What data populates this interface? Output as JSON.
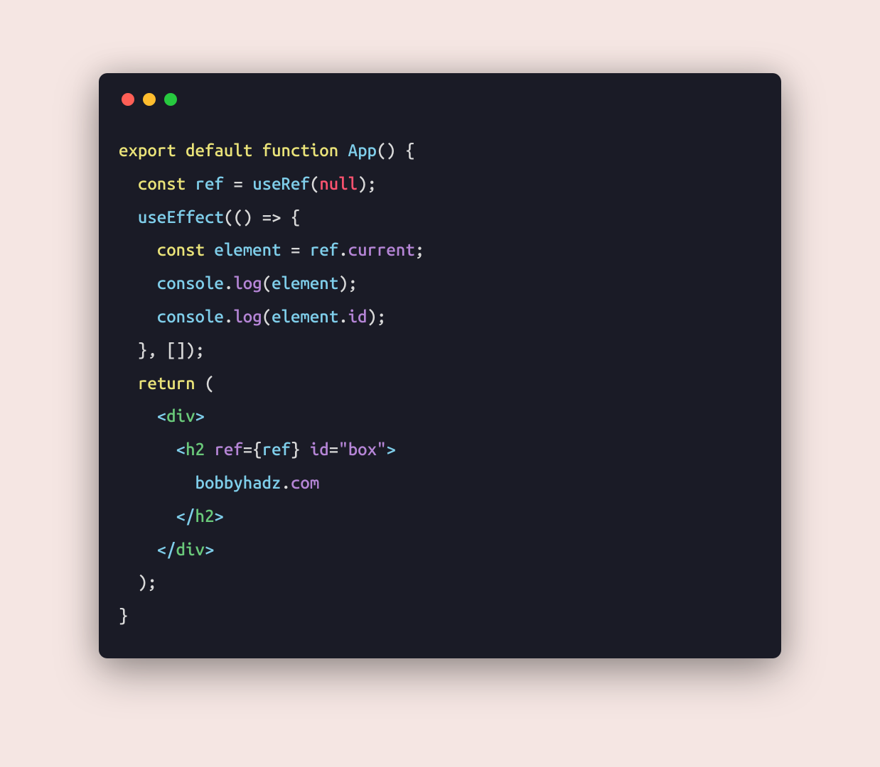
{
  "window": {
    "controls": [
      "close",
      "minimize",
      "maximize"
    ]
  },
  "code": {
    "line1": {
      "export": "export",
      "default": "default",
      "function": "function",
      "name": "App",
      "parens": "()",
      "brace": "{"
    },
    "line2": {
      "const": "const",
      "var": "ref",
      "eq": "=",
      "fn": "useRef",
      "lparen": "(",
      "null": "null",
      "rparen": ")",
      "semi": ";"
    },
    "line3": {
      "fn": "useEffect",
      "lparen": "(",
      "innerParens": "()",
      "arrow": "=>",
      "brace": "{"
    },
    "line4": {
      "const": "const",
      "var": "element",
      "eq": "=",
      "ref": "ref",
      "dot": ".",
      "prop": "current",
      "semi": ";"
    },
    "line5": {
      "obj": "console",
      "dot": ".",
      "method": "log",
      "lparen": "(",
      "arg": "element",
      "rparen": ")",
      "semi": ";"
    },
    "line6": {
      "obj": "console",
      "dot": ".",
      "method": "log",
      "lparen": "(",
      "arg": "element",
      "dot2": ".",
      "prop": "id",
      "rparen": ")",
      "semi": ";"
    },
    "line7": {
      "brace": "}",
      "comma": ",",
      "brackets": "[]",
      "rparen": ")",
      "semi": ";"
    },
    "line8": {
      "return": "return",
      "paren": "("
    },
    "line9": {
      "langle": "<",
      "tag": "div",
      "rangle": ">"
    },
    "line10": {
      "langle": "<",
      "tag": "h2",
      "attr1": "ref",
      "eq1": "=",
      "lbrace": "{",
      "var": "ref",
      "rbrace": "}",
      "attr2": "id",
      "eq2": "=",
      "str": "\"box\"",
      "rangle": ">"
    },
    "line11": {
      "text1": "bobbyhadz",
      "dot": ".",
      "text2": "com"
    },
    "line12": {
      "langle": "</",
      "tag": "h2",
      "rangle": ">"
    },
    "line13": {
      "langle": "</",
      "tag": "div",
      "rangle": ">"
    },
    "line14": {
      "paren": ")",
      "semi": ";"
    },
    "line15": {
      "brace": "}"
    }
  }
}
